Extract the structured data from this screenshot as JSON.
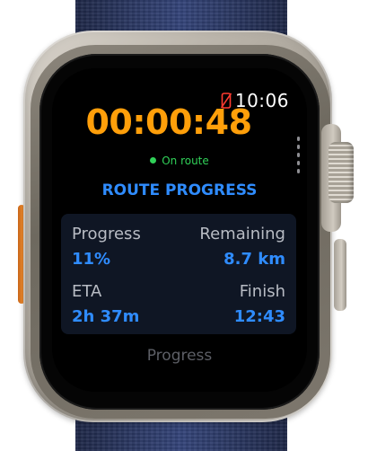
{
  "status": {
    "time": "10:06",
    "phone_icon": "iphone-disconnected-icon",
    "phone_icon_color": "#ff3b30"
  },
  "workout": {
    "timer": "00:00:48",
    "timer_color": "#ff9f0a",
    "route_status": "On route",
    "route_status_color": "#30d158"
  },
  "section": {
    "title": "ROUTE PROGRESS",
    "accent": "#2f8cff"
  },
  "stats": {
    "progress": {
      "label": "Progress",
      "value": "11%"
    },
    "remaining": {
      "label": "Remaining",
      "value": "8.7 km"
    },
    "eta": {
      "label": "ETA",
      "value": "2h 37m"
    },
    "finish": {
      "label": "Finish",
      "value": "12:43"
    }
  },
  "page": {
    "label": "Progress"
  }
}
